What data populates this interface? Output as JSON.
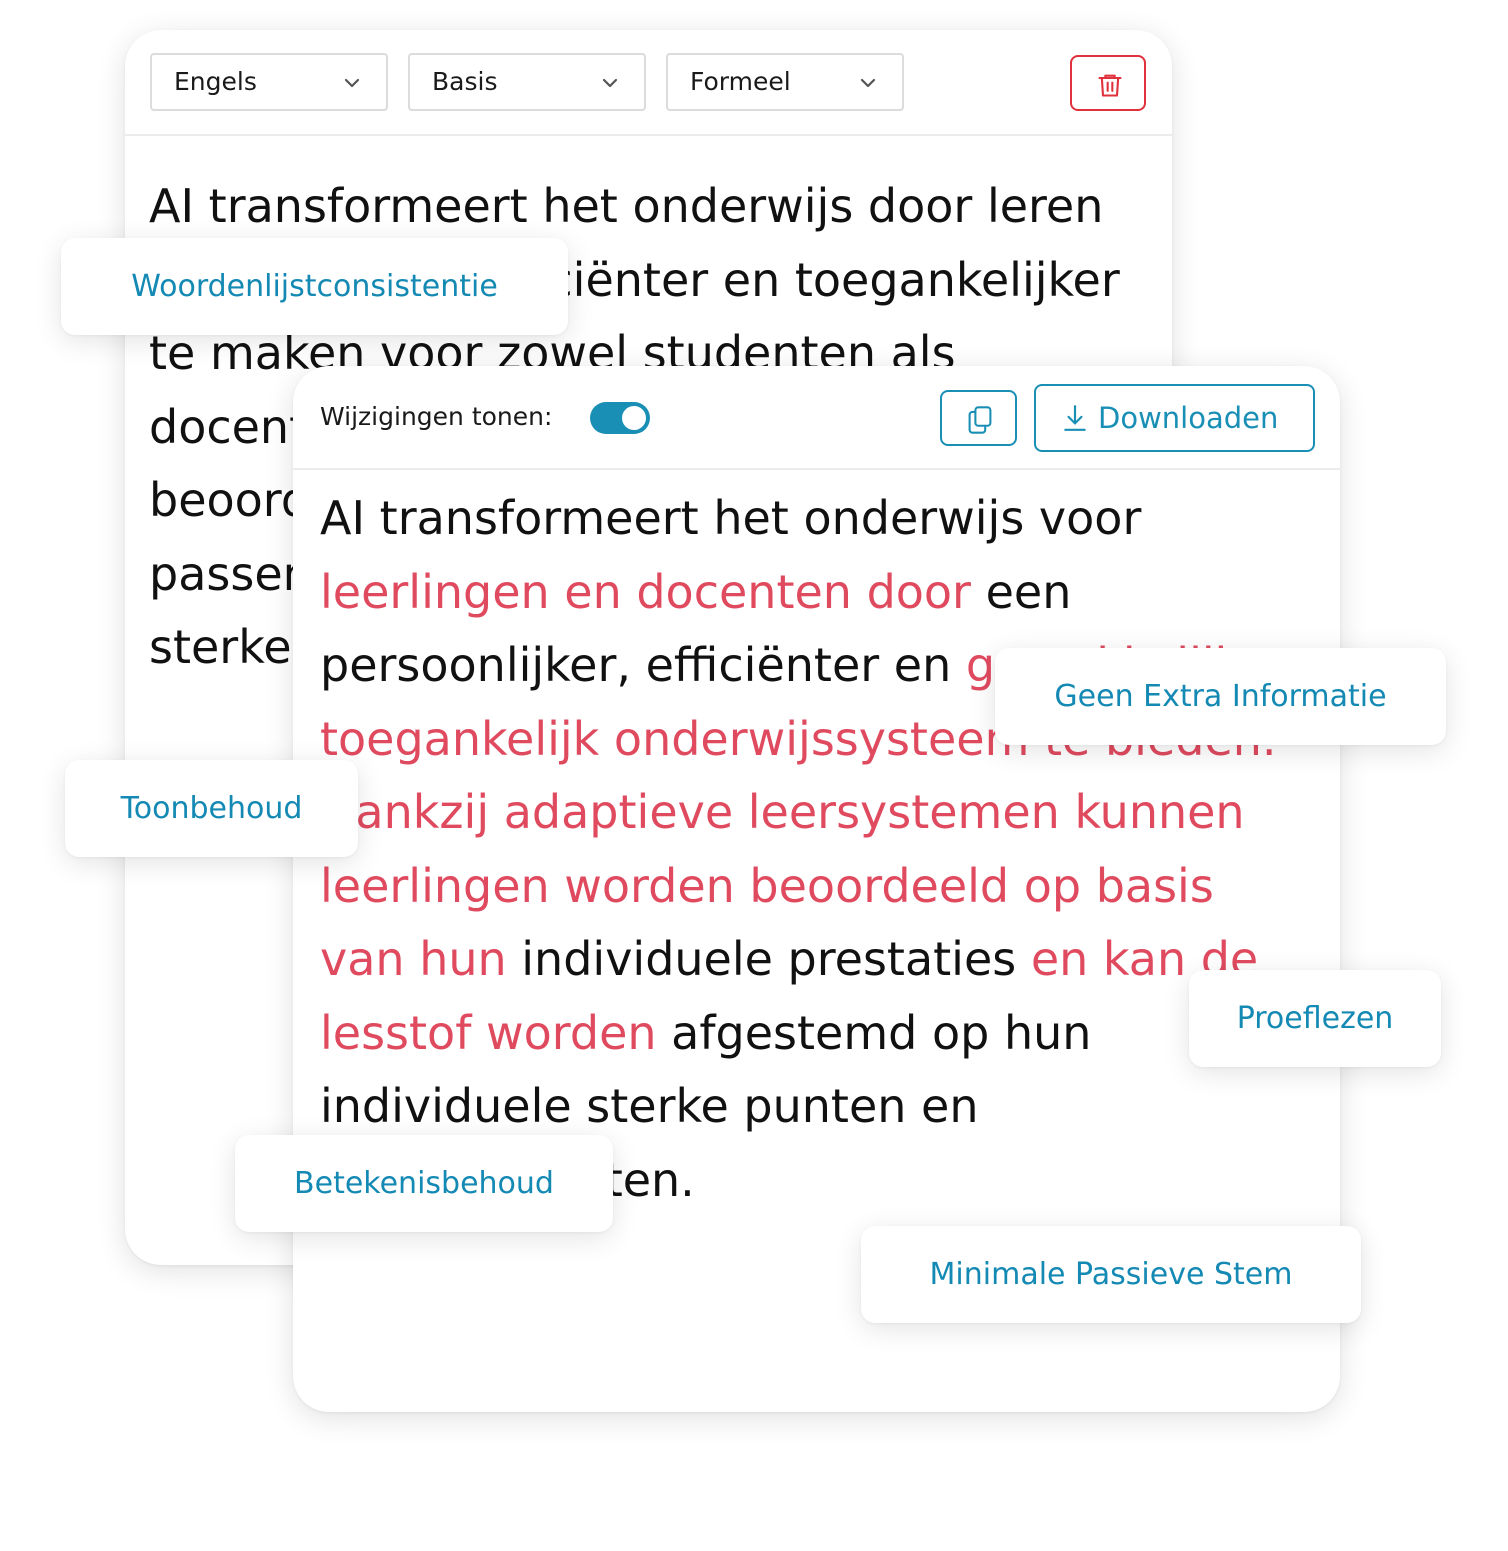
{
  "editor": {
    "language_select": "Engels",
    "level_select": "Basis",
    "tone_select": "Formeel",
    "original_text": "AI transformeert het onderwijs door leren persoonlijker, efficiënter en toegankelijker te maken voor zowel studenten als docenten. Adaptieve leersystemen beoordelen individuele prestaties en passen de lesstof aan, afgestemd op hun sterke punten en verbeterpunten."
  },
  "result": {
    "toggle_label": "Wijzigingen tonen:",
    "toggle_on": true,
    "download_label": "Downloaden",
    "segments": [
      {
        "text": "AI transformeert het onderwijs voor ",
        "changed": false
      },
      {
        "text": "leerlingen en docenten door",
        "changed": true
      },
      {
        "text": " een persoonlijker, efficiënter en ",
        "changed": false
      },
      {
        "text": "gemakkelijker toegankelijk onderwijssysteem te bieden. Dankzij adaptieve leersystemen kunnen leerlingen worden beoordeeld op basis van hun",
        "changed": true
      },
      {
        "text": " individuele prestaties ",
        "changed": false
      },
      {
        "text": "en kan de lesstof worden",
        "changed": true
      },
      {
        "text": " afgestemd op hun individuele sterke punten en verbeterpunten.",
        "changed": false
      }
    ]
  },
  "features": {
    "vocabulary": "Woordenlijstconsistentie",
    "no_extra_info": "Geen Extra Informatie",
    "tone": "Toonbehoud",
    "proofreading": "Proeflezen",
    "meaning": "Betekenisbehoud",
    "passive_voice": "Minimale Passieve Stem"
  },
  "colors": {
    "accent": "#1a8fb6",
    "change_highlight": "#e04a5f",
    "delete_red": "#e0313c"
  },
  "icons": [
    "chevron-down-icon",
    "trash-icon",
    "copy-icon",
    "download-icon"
  ]
}
